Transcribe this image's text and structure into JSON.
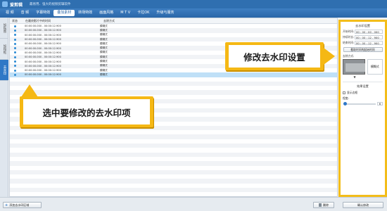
{
  "window": {
    "app_name": "爱剪辑",
    "slogan": "最易用、强大的视频剪辑软件"
  },
  "tabs": [
    "视 频",
    "音 频",
    "字幕特效",
    "叠加素材",
    "转场特效",
    "画面风格",
    "M T V",
    "卡拉OK",
    "升级与服务"
  ],
  "active_tab": 3,
  "left_tabs": [
    "加贴图",
    "加相框",
    "去水印"
  ],
  "left_active": 2,
  "table": {
    "headers": {
      "status": "状态",
      "time": "在最终影片中的时间",
      "method": "去除方式"
    },
    "rows": [
      {
        "time": "00:00:00.000 - 00:00:12.900",
        "method": "模糊式"
      },
      {
        "time": "00:00:00.000 - 00:00:12.900",
        "method": "模糊式"
      },
      {
        "time": "00:00:00.000 - 00:00:12.900",
        "method": "模糊式"
      },
      {
        "time": "00:00:00.000 - 00:00:12.900",
        "method": "模糊式"
      },
      {
        "time": "00:00:00.000 - 00:00:12.900",
        "method": "模糊式"
      },
      {
        "time": "00:00:00.000 - 00:00:12.900",
        "method": "模糊式"
      },
      {
        "time": "00:00:00.000 - 00:00:12.900",
        "method": "模糊式"
      },
      {
        "time": "00:00:00.000 - 00:00:12.900",
        "method": "模糊式"
      },
      {
        "time": "00:00:00.000 - 00:00:12.900",
        "method": "模糊式"
      },
      {
        "time": "00:00:00.000 - 00:00:12.900",
        "method": "模糊式"
      },
      {
        "time": "00:00:00.000 - 00:00:12.900",
        "method": "模糊式"
      },
      {
        "time": "00:00:00.000 - 00:00:12.900",
        "method": "模糊式"
      }
    ],
    "selected_index": 11
  },
  "panel": {
    "section1_title": "去水印设置",
    "start_label": "开始时间:",
    "start_value": "00 : 00 : 00 . 000",
    "duration_label": "持续时长:",
    "duration_value": "00 : 00 : 12 . 900",
    "end_label": "结束时间:",
    "end_value": "00 : 00 : 12 . 900",
    "pick_button": "截取时间的起始时间",
    "method_label": "去除方式:",
    "method_value": "模糊式",
    "section2_title": "效果设置",
    "check_label": "显示边框",
    "degree_label": "程度:",
    "degree_value": "6"
  },
  "bottom": {
    "add_button": "添加去水印区域",
    "delete_button": "删除",
    "ok_button": "确认修改"
  },
  "callouts": {
    "right": "修改去水印设置",
    "left": "选中要修改的去水印项"
  },
  "colors": {
    "accent": "#2f78c6",
    "callout": "#f5b814",
    "selected_row": "#bfe0f7"
  }
}
